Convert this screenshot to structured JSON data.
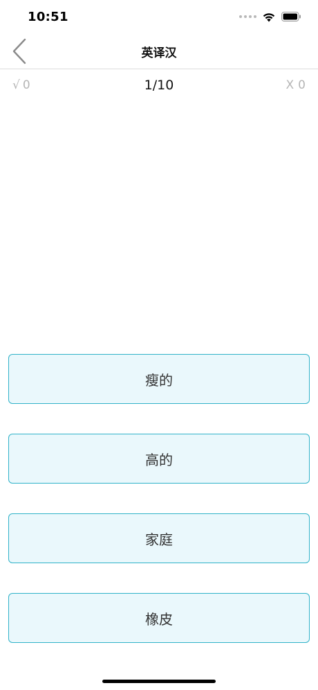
{
  "status_bar": {
    "time": "10:51",
    "icons": [
      "cellular-signal-icon",
      "wifi-icon",
      "battery-icon"
    ]
  },
  "nav": {
    "back_icon": "chevron-left-icon",
    "title": "英译汉"
  },
  "score": {
    "correct_symbol": "√",
    "correct_count": "0",
    "progress": "1/10",
    "wrong_symbol": "X",
    "wrong_count": "0"
  },
  "options": [
    {
      "label": "瘦的"
    },
    {
      "label": "高的"
    },
    {
      "label": "家庭"
    },
    {
      "label": "橡皮"
    }
  ],
  "colors": {
    "option_border": "#2fb2c8",
    "option_background": "#eaf8fc",
    "score_muted": "#b5b5b5"
  }
}
